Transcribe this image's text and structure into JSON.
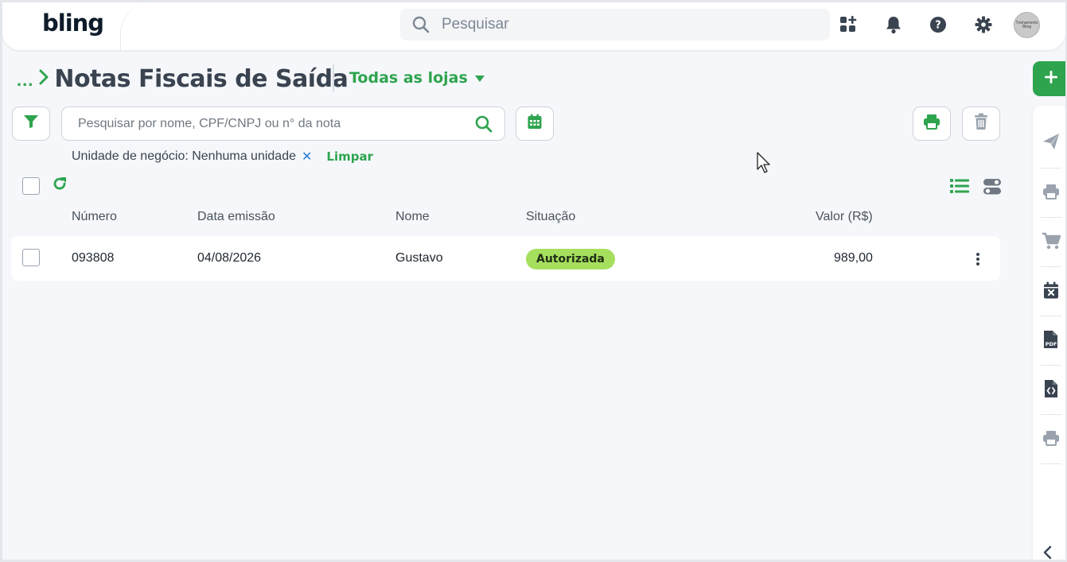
{
  "header": {
    "logo": "bling",
    "search_placeholder": "Pesquisar",
    "icons": [
      "apps-add-icon",
      "bell-icon",
      "help-icon",
      "gear-icon"
    ],
    "avatar_text": "Treinamento Bling"
  },
  "page": {
    "breadcrumb_dots": "...",
    "title": "Notas Fiscais de Saída",
    "store_filter": "Todas as lojas"
  },
  "toolbar": {
    "search_placeholder": "Pesquisar por nome, CPF/CNPJ ou n° da nota"
  },
  "filters": {
    "chip_label": "Unidade de negócio: Nenhuma unidade",
    "chip_remove": "✕",
    "clear_label": "Limpar"
  },
  "table": {
    "columns": [
      "Número",
      "Data emissão",
      "Nome",
      "Situação",
      "Valor (R$)"
    ],
    "rows": [
      {
        "numero": "093808",
        "data": "04/08/2026",
        "nome": "Gustavo",
        "situacao": "Autorizada",
        "valor": "989,00"
      }
    ]
  },
  "colors": {
    "brand_green": "#2ea44f",
    "badge_green": "#a6df5e",
    "icon_gray": "#9aa3ad",
    "icon_dark": "#3a4350"
  }
}
